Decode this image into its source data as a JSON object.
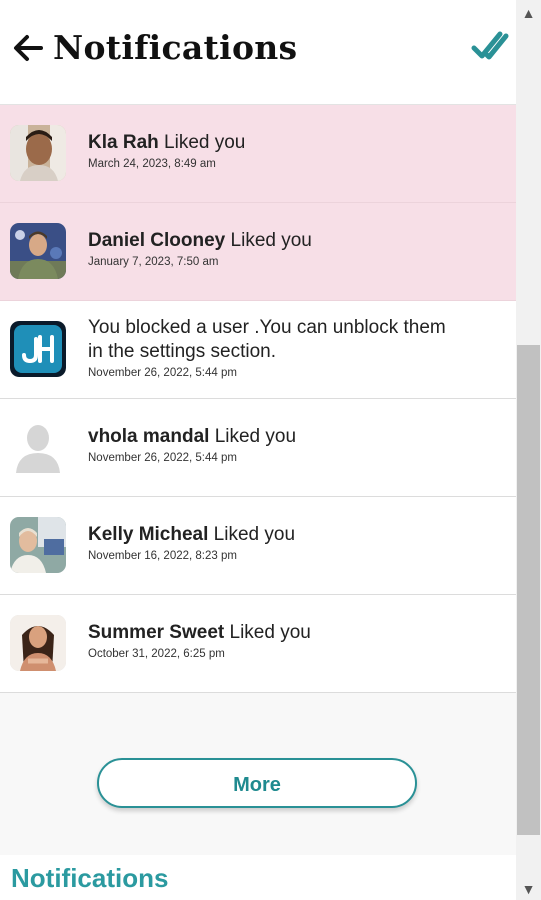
{
  "header": {
    "title": "Notifications",
    "back_icon": "arrow-left-icon",
    "mark_read_icon": "double-check-icon",
    "accent": "#2a9196"
  },
  "notifications": [
    {
      "name": "Kla Rah",
      "action": "Liked you",
      "time": "March 24, 2023, 8:49 am",
      "unread": true
    },
    {
      "name": "Daniel Clooney",
      "action": "Liked you",
      "time": "January 7, 2023, 7:50 am",
      "unread": true
    },
    {
      "message_line1": "You blocked a user .You can unblock them",
      "message_line2": "in the settings section.",
      "time": "November 26, 2022, 5:44 pm",
      "unread": false
    },
    {
      "name": "vhola mandal",
      "action": "Liked you",
      "time": "November 26, 2022, 5:44 pm",
      "unread": false
    },
    {
      "name": "Kelly Micheal",
      "action": "Liked you",
      "time": "November 16, 2022, 8:23 pm",
      "unread": false
    },
    {
      "name": "Summer Sweet",
      "action": "Liked you",
      "time": "October 31, 2022, 6:25 pm",
      "unread": false
    }
  ],
  "more_button": {
    "label": "More"
  },
  "footer": {
    "title": "Notifications"
  },
  "colors": {
    "unread_bg": "#f7dfe7",
    "brand_teal": "#2b9aa0"
  }
}
